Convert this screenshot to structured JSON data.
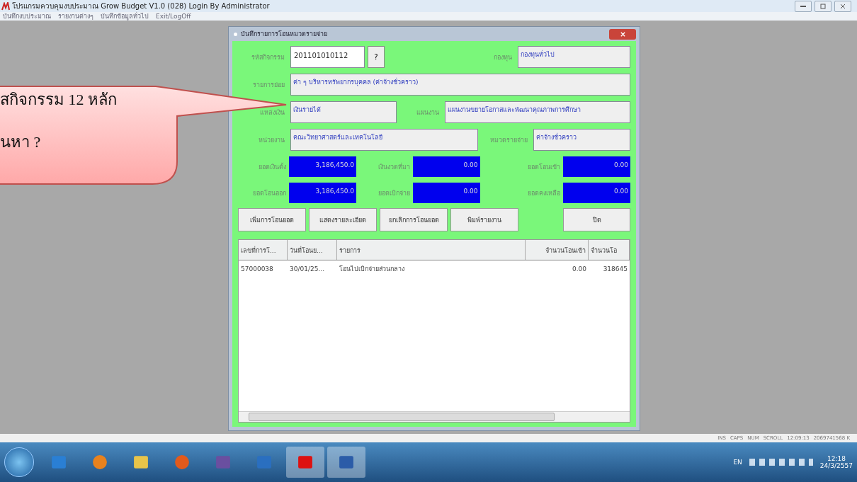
{
  "window": {
    "title": "โปรแกรมควบคุมงบประมาณ Grow Budget V1.0 (028) Login By Administrator"
  },
  "menu": [
    "บันทึกงบประมาณ",
    "รายงานต่างๆ",
    "บันทึกข้อมูลทั่วไป",
    "Exit/LogOff"
  ],
  "dialog": {
    "title": "บันทึกรายการโอนหมวดรายจ่าย",
    "code": {
      "label": "รหัสกิจกรรม",
      "value": "201101010112",
      "lookup": "?"
    },
    "fields": [
      {
        "label": "กองทุน",
        "value": "กองทุนทั่วไป"
      },
      {
        "label": "รายการย่อย",
        "value": "ค่า ๆ บริหารทรัพยากรบุคคล (ค่าจ้างชั่วคราว)"
      },
      {
        "label": "แหล่งเงิน",
        "value": "เงินรายได้"
      },
      {
        "label": "แผนงาน",
        "value": "แผนงานขยายโอกาสและพัฒนาคุณภาพการศึกษา"
      },
      {
        "label": "หน่วยงาน",
        "value": "คณะวิทยาศาสตร์และเทคโนโลยี"
      },
      {
        "label": "หมวดรายจ่าย",
        "value": "ค่าจ้างชั่วคราว"
      }
    ],
    "amounts": [
      {
        "label": "ยอดเงินตั้ง",
        "value": "3,186,450.0"
      },
      {
        "label": "เงินงวดที่มา",
        "value": "0.00"
      },
      {
        "label": "ยอดโอนเข้า",
        "value": "0.00"
      },
      {
        "label": "ยอดโอนออก",
        "value": "3,186,450.0"
      },
      {
        "label": "ยอดเบิกจ่าย",
        "value": "0.00"
      },
      {
        "label": "ยอดคงเหลือ",
        "value": "0.00"
      }
    ],
    "buttons": [
      "เพิ่มการโอนยอด",
      "แสดงรายละเอียด",
      "ยกเลิกการโอนยอด",
      "พิมพ์รายงาน",
      "ปิด"
    ],
    "table": {
      "columns": [
        "เลขที่การโ...",
        "วันที่โอนย...",
        "รายการ",
        "จำนวนโอนเข้า",
        "จำนวนโอ"
      ],
      "rows": [
        [
          "57000038",
          "30/01/25...",
          "โอนไปเบิกจ่ายส่วนกลาง",
          "0.00",
          "318645"
        ]
      ]
    }
  },
  "callout": {
    "lines": [
      "สกิจกรรม 12 หลัก",
      "นหา ?"
    ]
  },
  "status_bar": [
    "INS",
    "CAPS",
    "NUM",
    "SCROLL",
    "12:09:13",
    "2069741568 K"
  ],
  "taskbar": {
    "language": "EN",
    "time": "12:18",
    "date": "24/3/2557"
  }
}
